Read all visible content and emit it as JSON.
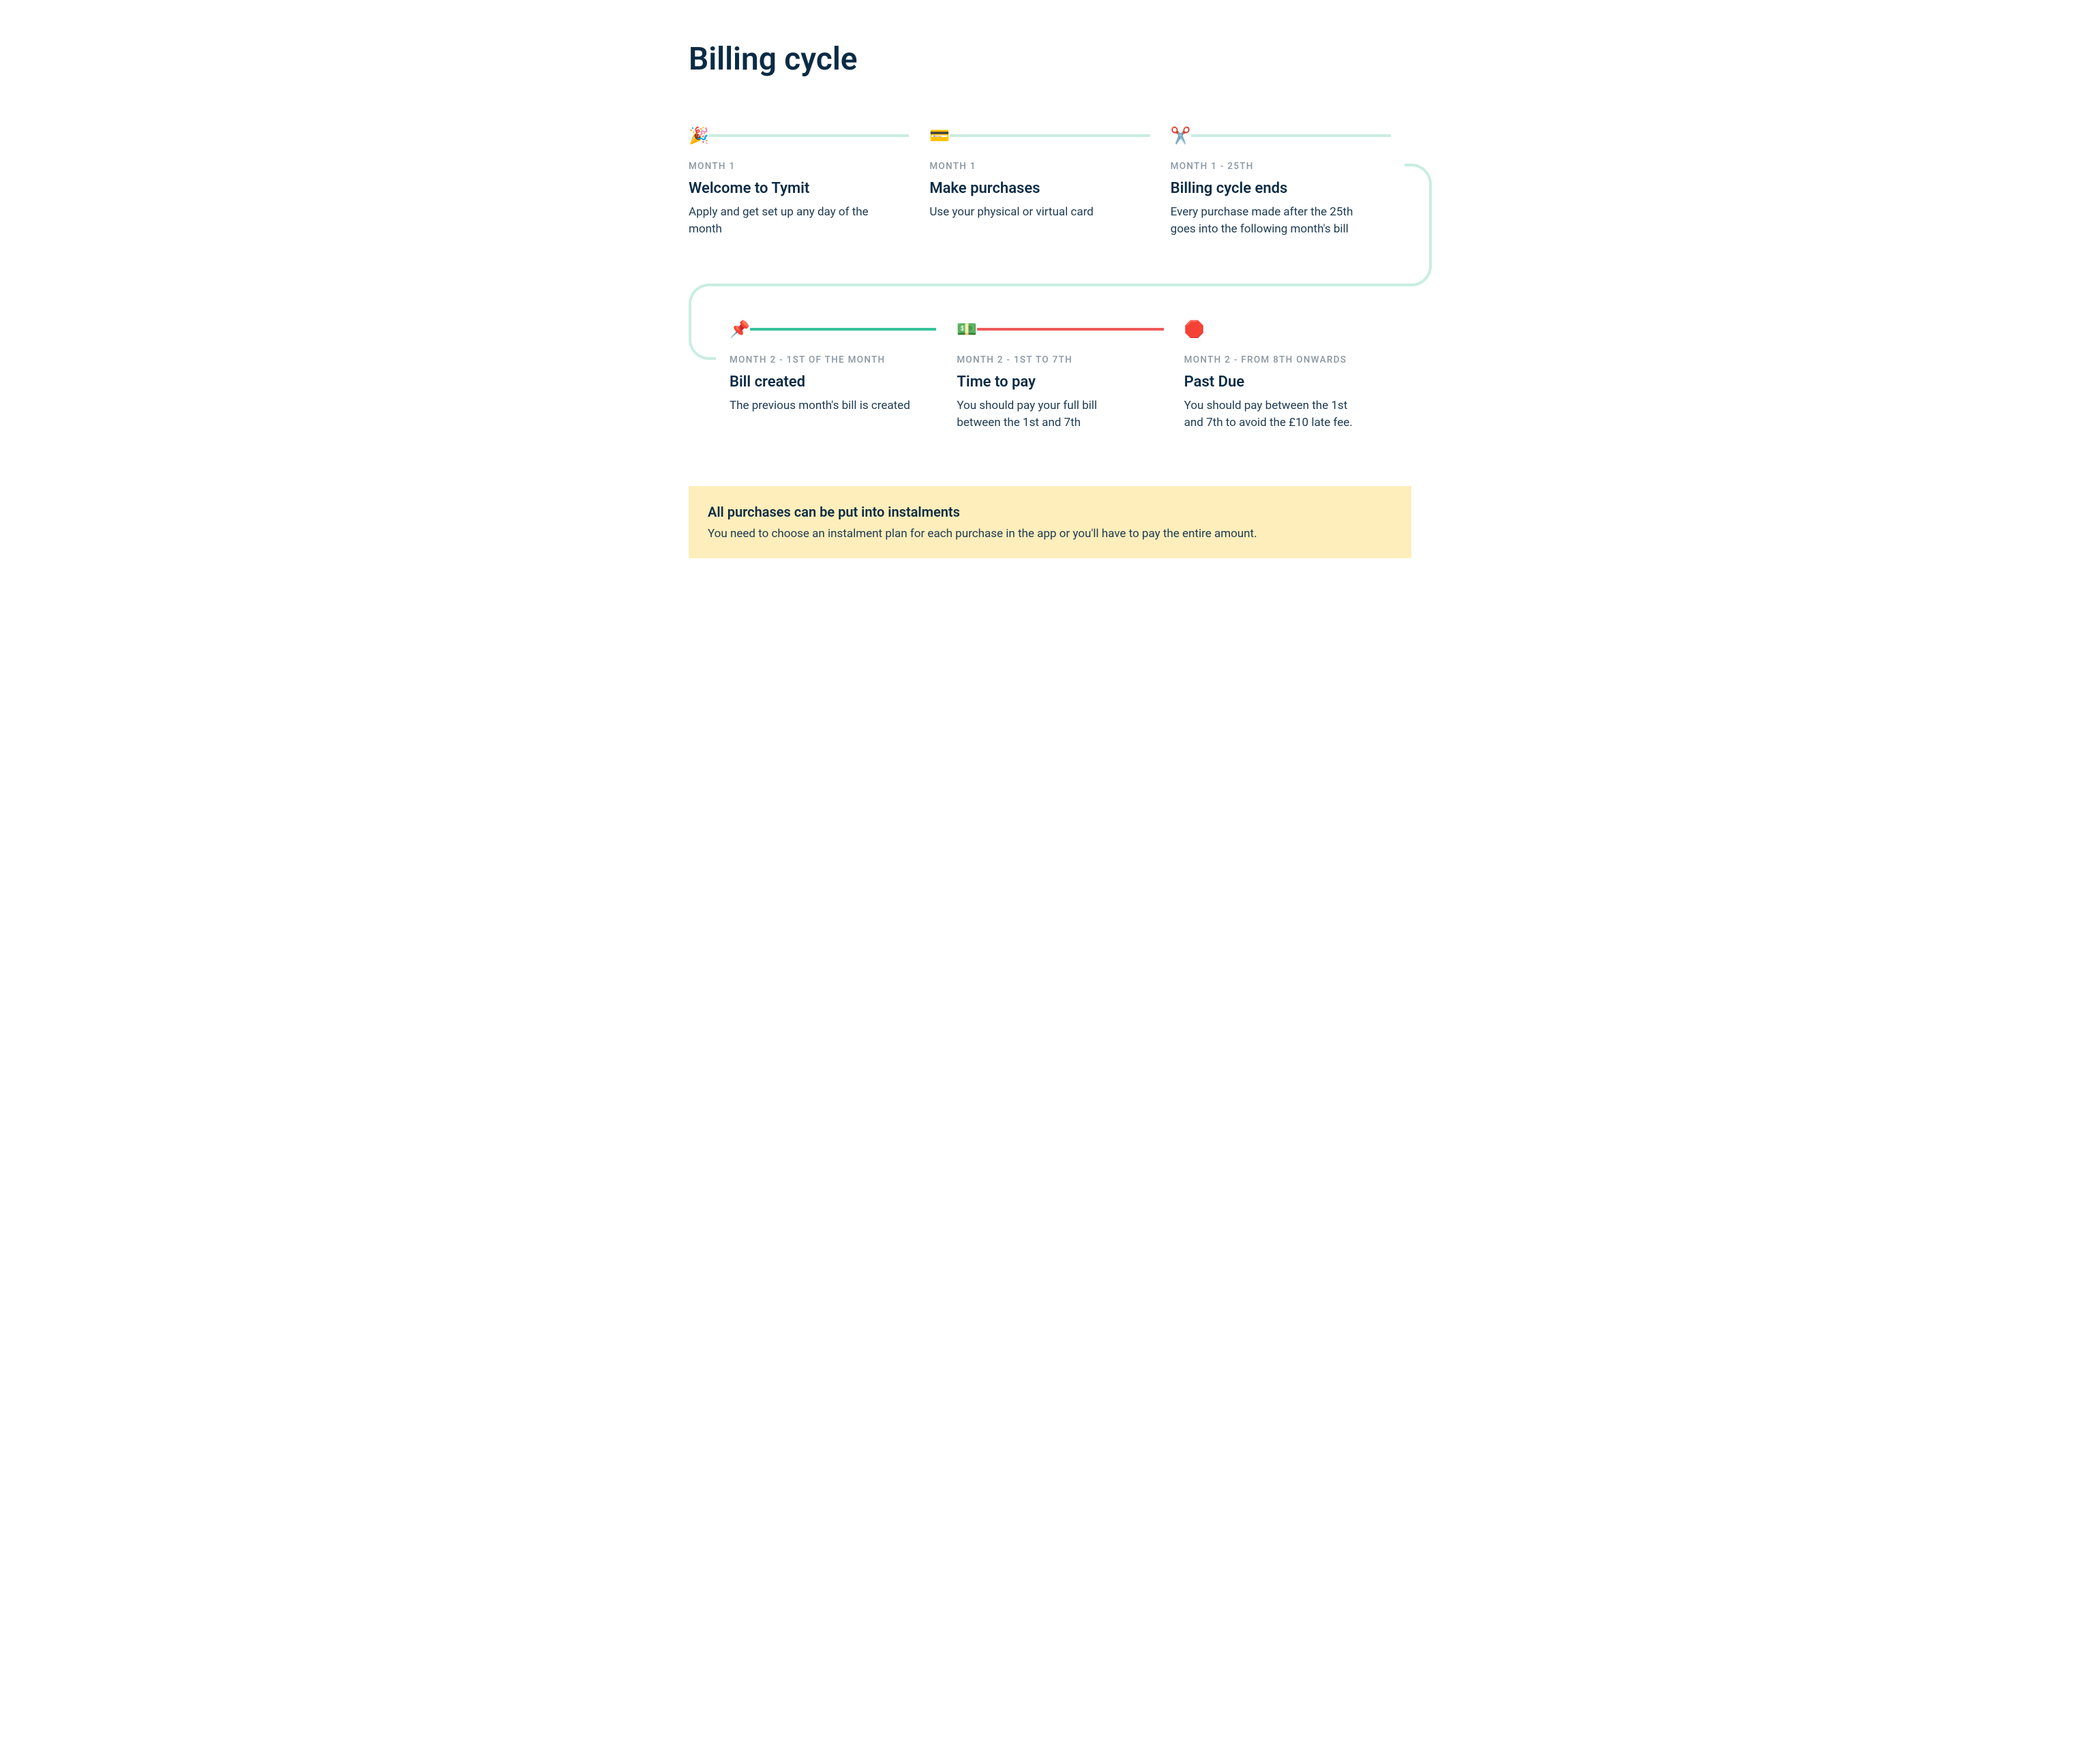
{
  "title": "Billing cycle",
  "steps_row1": [
    {
      "icon": "🎉",
      "eyebrow": "MONTH 1",
      "title": "Welcome to Tymit",
      "desc": "Apply and get set up any day of the month"
    },
    {
      "icon": "💳",
      "eyebrow": "MONTH 1",
      "title": "Make purchases",
      "desc": "Use your physical or virtual card"
    },
    {
      "icon": "✂️",
      "eyebrow": "MONTH 1 - 25TH",
      "title": "Billing cycle ends",
      "desc": "Every purchase made after the 25th goes into the following month's bill"
    }
  ],
  "steps_row2": [
    {
      "icon": "📌",
      "eyebrow": "MONTH 2 - 1ST OF THE MONTH",
      "title": "Bill created",
      "desc": "The previous month's bill is created"
    },
    {
      "icon": "💵",
      "eyebrow": "MONTH 2 - 1ST TO 7TH",
      "title": "Time to pay",
      "desc": "You should pay your full bill between the 1st and 7th"
    },
    {
      "icon": "🛑",
      "eyebrow": "MONTH 2 - FROM 8TH ONWARDS",
      "title": "Past Due",
      "desc": "You should pay between the 1st and 7th to avoid the £10 late fee."
    }
  ],
  "notice": {
    "title": "All purchases can be put into instalments",
    "body": "You need to choose an instalment plan for each purchase in the app or you'll have to pay the entire amount."
  }
}
